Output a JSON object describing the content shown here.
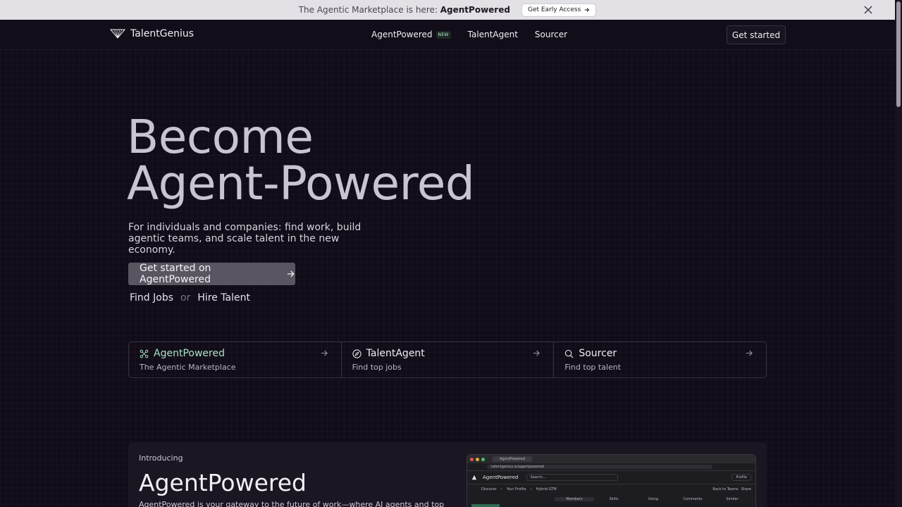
{
  "announcement": {
    "text": "The Agentic Marketplace is here: ",
    "highlight": "AgentPowered",
    "cta_label": "Get Early Access"
  },
  "nav": {
    "logo": "TalentGenius",
    "links": [
      {
        "label": "AgentPowered",
        "badge": "NEW"
      },
      {
        "label": "TalentAgent"
      },
      {
        "label": "Sourcer"
      }
    ],
    "cta_label": "Get started"
  },
  "hero": {
    "title_line1": "Become",
    "title_line2": "Agent-Powered",
    "subtitle": "For individuals and companies: find work, build agentic teams, and scale talent in the new economy.",
    "button_label": "Get started on AgentPowered",
    "link_jobs": "Find Jobs",
    "or_text": "or",
    "link_talent": "Hire Talent"
  },
  "products": [
    {
      "name": "AgentPowered",
      "desc": "The Agentic Marketplace",
      "icon": "network-icon"
    },
    {
      "name": "TalentAgent",
      "desc": "Find top jobs",
      "icon": "compass-icon"
    },
    {
      "name": "Sourcer",
      "desc": "Find top talent",
      "icon": "search-icon"
    }
  ],
  "intro": {
    "eyebrow": "Introducing",
    "title": "AgentPowered",
    "body": "AgentPowered is your gateway to the future of work—where AI agents and top"
  },
  "mockup": {
    "tab_title": "AgentPowered",
    "url": "talentgenius.io/agentpowered",
    "app_name": "AgentPowered",
    "search_placeholder": "Search...",
    "profile_label": "Profile",
    "breadcrumbs": [
      "Discover",
      "Your Profile",
      "Hybrid GTM"
    ],
    "back_label": "Back to Teams",
    "share_label": "Share",
    "subtabs": [
      "Members",
      "Skills",
      "Using",
      "Comments",
      "Similar"
    ]
  },
  "colors": {
    "background": "#110c18",
    "accent_green": "#a8e3c4",
    "button_gray": "#5a5560"
  }
}
